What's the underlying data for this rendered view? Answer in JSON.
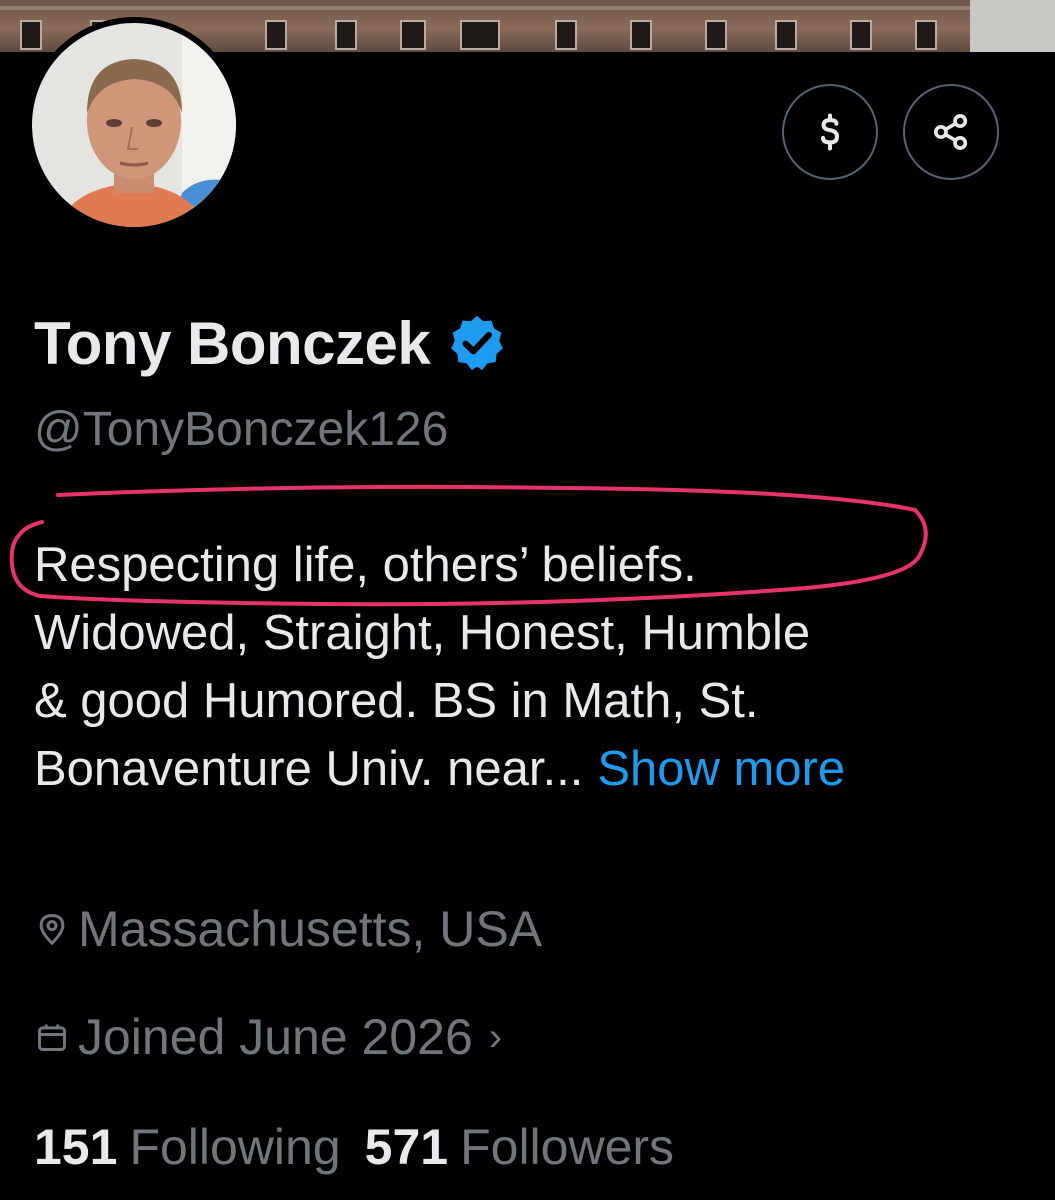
{
  "profile": {
    "display_name": "Tony Bonczek",
    "handle": "@TonyBonczek126",
    "verified_icon": "verified-badge-icon",
    "bio_lines": [
      "Respecting life, others’ beliefs.",
      "Widowed, Straight, Honest, Humble",
      "& good Humored. BS in Math, St.",
      "Bonaventure Univ. near..."
    ],
    "show_more_label": "Show more",
    "location": "Massachusetts, USA",
    "joined": "Joined June 2026",
    "joined_chevron": "›",
    "following_count": "151",
    "following_label": "Following",
    "followers_count": "571",
    "followers_label": "Followers"
  },
  "actions": {
    "tip_icon": "dollar-icon",
    "share_icon": "share-icon"
  },
  "colors": {
    "background": "#000000",
    "primary_text": "#e7e9ea",
    "secondary_text": "#71767b",
    "link": "#1d9bf0",
    "verified": "#1d9bf0",
    "annotation": "#e8326a",
    "button_border": "#536471"
  }
}
